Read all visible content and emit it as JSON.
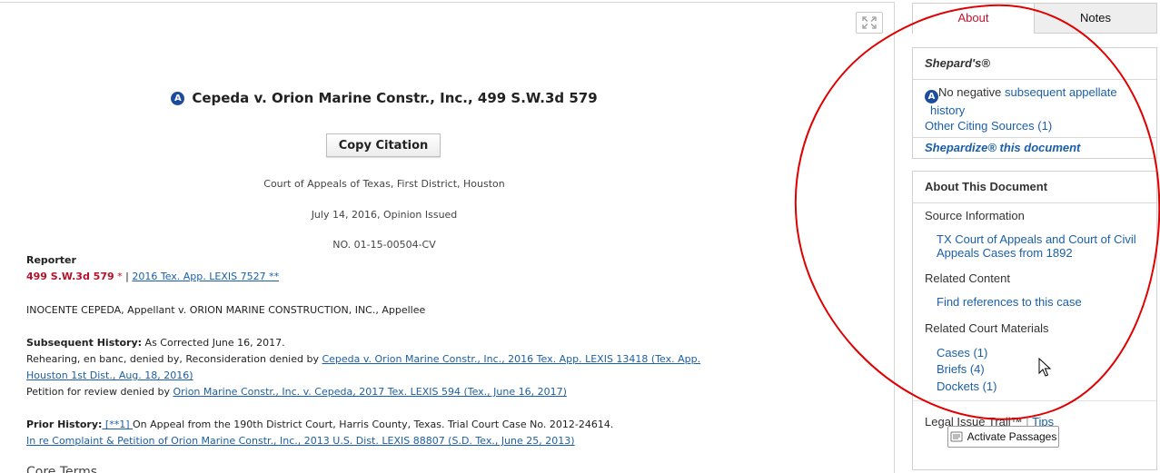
{
  "doc": {
    "title": "Cepeda v. Orion Marine Constr., Inc., 499 S.W.3d 579",
    "badge": "A",
    "copy_citation_label": "Copy Citation",
    "court": "Court of Appeals of Texas, First District, Houston",
    "date": "July 14, 2016, Opinion Issued",
    "number": "NO. 01-15-00504-CV",
    "reporter_label": "Reporter",
    "reporter_cite": "499 S.W.3d 579",
    "reporter_star": "*",
    "reporter_sep": "|",
    "reporter_link": "2016 Tex. App. LEXIS 7527 **",
    "parties": "INOCENTE CEPEDA, Appellant v. ORION MARINE CONSTRUCTION, INC., Appellee",
    "subsequent_label": "Subsequent History:",
    "subsequent_text": " As Corrected June 16, 2017.",
    "rehearing_text": "Rehearing, en banc, denied by, Reconsideration denied by ",
    "rehearing_link_1": "Cepeda v. Orion Marine Constr., Inc., 2016 Tex. App. LEXIS 13418 (Tex. App.",
    "rehearing_link_2": "Houston 1st Dist., Aug. 18, 2016)",
    "petition_text": "Petition for review denied by ",
    "petition_link": "Orion Marine Constr., Inc. v. Cepeda, 2017 Tex. LEXIS 594 (Tex., June 16, 2017)",
    "prior_label": "Prior History:",
    "prior_star_link": " [**1] ",
    "prior_text": "On Appeal from the 190th District Court, Harris County, Texas. Trial Court Case No. 2012-24614.",
    "prior_link": "In re Complaint & Petition of Orion Marine Constr., Inc., 2013 U.S. Dist. LEXIS 88807 (S.D. Tex., June 25, 2013)",
    "cut_heading": "Core Terms"
  },
  "tabs": {
    "about": "About",
    "notes": "Notes"
  },
  "shepards": {
    "heading": "Shepard's®",
    "badge": "A",
    "no_negative": "No negative ",
    "subsequent_link_1": "subsequent appellate",
    "subsequent_link_2": "history",
    "other_citing": "Other Citing Sources (1)",
    "shepardize": "Shepardize® this document"
  },
  "about": {
    "heading": "About This Document",
    "source_label": "Source Information",
    "source_link_1": "TX Court of Appeals and Court of Civil",
    "source_link_2": "Appeals Cases from 1892",
    "related_content_label": "Related Content",
    "find_refs": "Find references to this case",
    "related_materials_label": "Related Court Materials",
    "cases": "Cases (1)",
    "briefs": "Briefs (4)",
    "dockets": "Dockets (1)",
    "legal_issue": "Legal Issue Trail™",
    "sep": "|",
    "tips": "Tips",
    "activate": "Activate Passages"
  },
  "colors": {
    "link": "#1a5fa8",
    "about_tab": "#c8102e",
    "reporter_red": "#b5122a",
    "annotation_red": "#e00000",
    "badge_blue": "#1d4c9c"
  }
}
